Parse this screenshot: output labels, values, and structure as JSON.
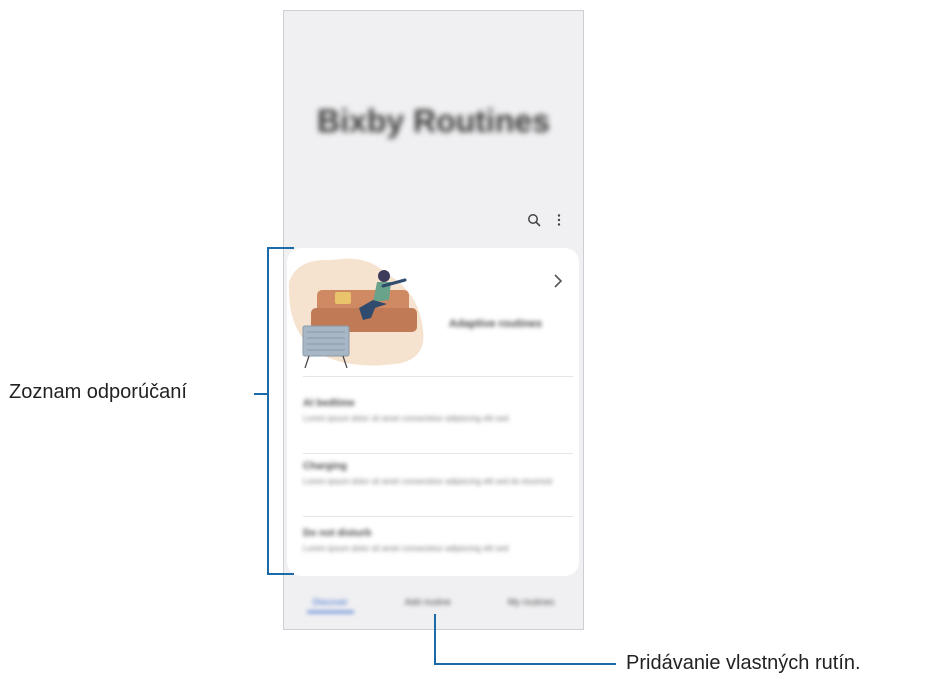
{
  "app": {
    "title": "Bixby Routines"
  },
  "toolbar": {
    "search_icon": "search-icon",
    "more_icon": "more-vertical-icon"
  },
  "feature_card": {
    "title": "Adaptive routines",
    "chevron_icon": "chevron-right-icon",
    "illustration": "person-on-sofa-watching-tv-illustration"
  },
  "recommendations": [
    {
      "title": "At bedtime",
      "description": "Lorem ipsum dolor sit amet consectetur adipiscing elit sed"
    },
    {
      "title": "Charging",
      "description": "Lorem ipsum dolor sit amet consectetur adipiscing elit sed do eiusmod"
    },
    {
      "title": "Do not disturb",
      "description": "Lorem ipsum dolor sit amet consectetur adipiscing elit sed"
    }
  ],
  "tabs": [
    {
      "label": "Discover",
      "active": true
    },
    {
      "label": "Add routine",
      "active": false
    },
    {
      "label": "My routines",
      "active": false
    }
  ],
  "callouts": {
    "list": "Zoznam odporúčaní",
    "add": "Pridávanie vlastných rutín."
  },
  "colors": {
    "accent": "#3f6fd1",
    "callout_line": "#1c6aa8"
  }
}
